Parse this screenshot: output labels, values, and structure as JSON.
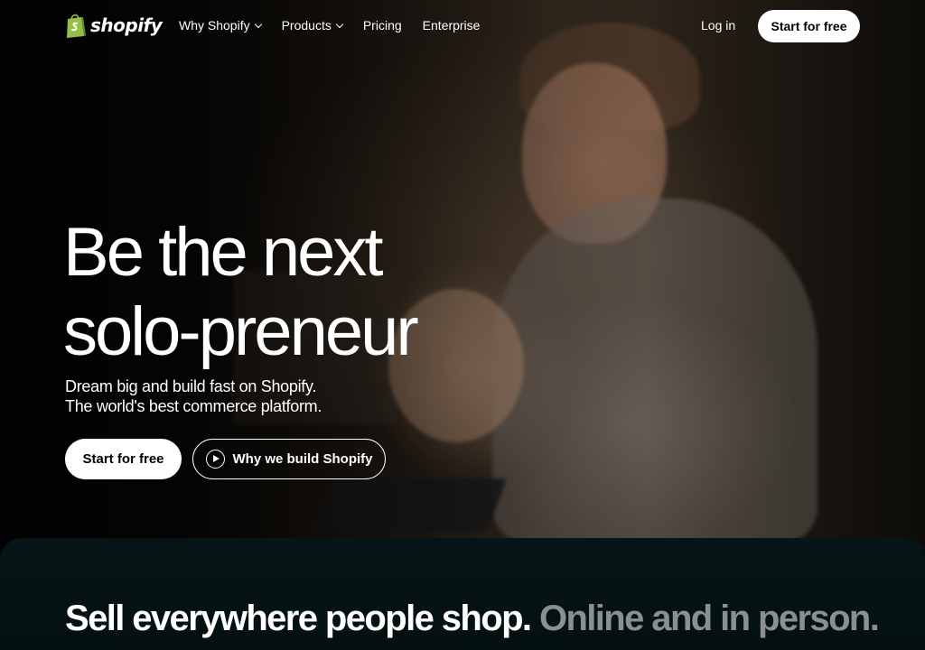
{
  "nav": {
    "logo_text": "shopify",
    "links": [
      {
        "label": "Why Shopify",
        "has_dropdown": true
      },
      {
        "label": "Products",
        "has_dropdown": true
      },
      {
        "label": "Pricing",
        "has_dropdown": false
      },
      {
        "label": "Enterprise",
        "has_dropdown": false
      }
    ],
    "login_label": "Log in",
    "cta_label": "Start for free"
  },
  "hero": {
    "headline_line1": "Be the next",
    "headline_line2": "solo-preneur",
    "sub_line1": "Dream big and build fast on Shopify.",
    "sub_line2": "The world's best commerce platform.",
    "primary_cta": "Start for free",
    "secondary_cta": "Why we build Shopify"
  },
  "panel": {
    "headline_strong": "Sell everywhere people shop.",
    "headline_muted": "Online and in person."
  },
  "colors": {
    "brand_green": "#95bf47",
    "brand_green_dark": "#5e8e3e",
    "panel_bg": "#071518",
    "muted_text": "#8a8f92"
  }
}
